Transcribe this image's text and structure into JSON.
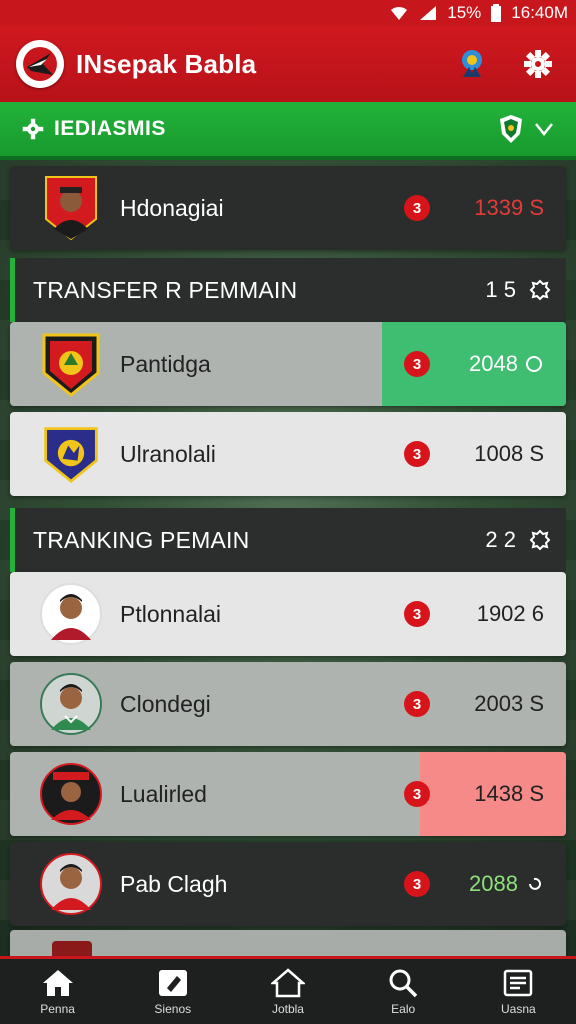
{
  "status": {
    "battery": "15%",
    "time": "16:40M"
  },
  "header": {
    "title": "INsepak Babla"
  },
  "filter": {
    "label": "IEDIASMIS"
  },
  "top_item": {
    "name": "Hdonagiai",
    "badge": "3",
    "value": "1339 S"
  },
  "transfer_section": {
    "title": "TRANSFER R PEMMAIN",
    "count": "1 5",
    "items": [
      {
        "name": "Pantidga",
        "badge": "3",
        "value": "2048"
      },
      {
        "name": "Ulranolali",
        "badge": "3",
        "value": "1008 S"
      }
    ]
  },
  "ranking_section": {
    "title": "TRANKING PEMAIN",
    "count": "2 2",
    "items": [
      {
        "name": "Ptlonnalai",
        "badge": "3",
        "value": "1902 6"
      },
      {
        "name": "Clondegi",
        "badge": "3",
        "value": "2003 S"
      },
      {
        "name": "Lualirled",
        "badge": "3",
        "value": "1438 S"
      },
      {
        "name": "Pab Clagh",
        "badge": "3",
        "value": "2088"
      }
    ]
  },
  "nav": [
    {
      "label": "Penna",
      "icon": "home-icon"
    },
    {
      "label": "Sienos",
      "icon": "edit-icon"
    },
    {
      "label": "Jotbla",
      "icon": "house-icon"
    },
    {
      "label": "Ealo",
      "icon": "search-icon"
    },
    {
      "label": "Uasna",
      "icon": "list-icon"
    }
  ],
  "colors": {
    "brand_red": "#c8161d",
    "accent_green": "#23b23a",
    "positive_highlight": "#3fbe72",
    "negative_highlight": "#f58a88"
  }
}
